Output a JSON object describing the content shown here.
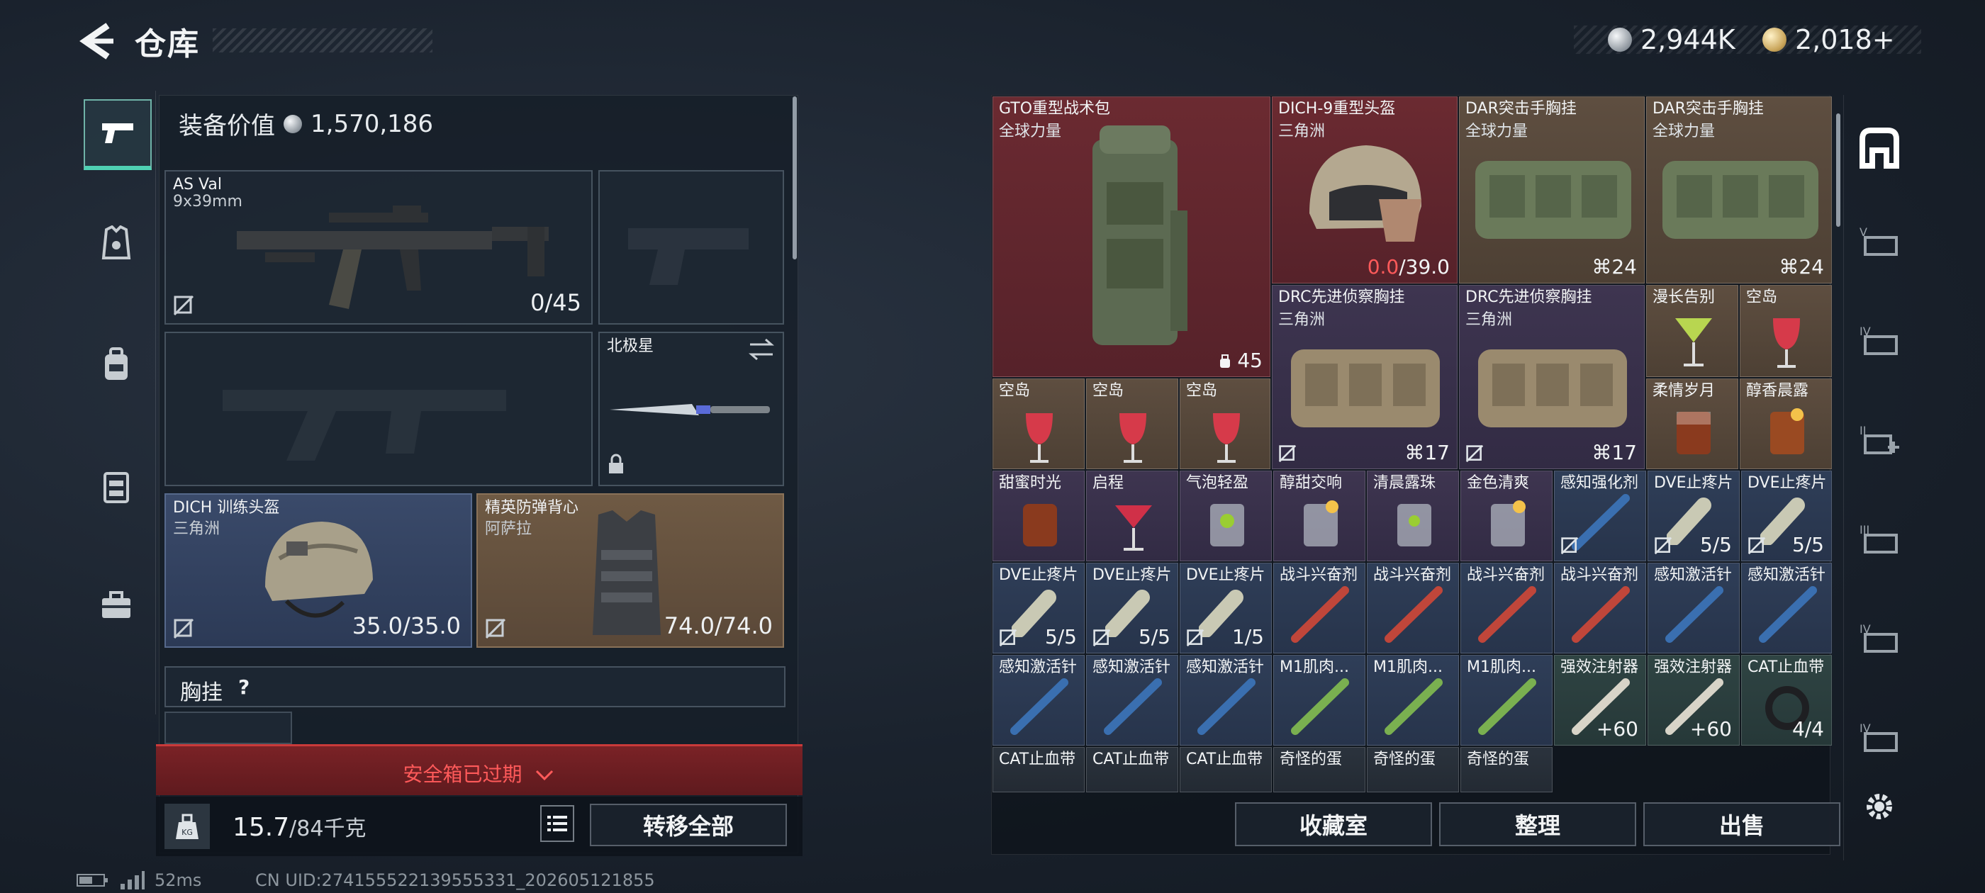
{
  "header": {
    "title": "仓库",
    "currency_silver": "2,944K",
    "currency_gold": "2,018+"
  },
  "equipment": {
    "value_label": "装备价值",
    "value": "1,570,186",
    "weapon1": {
      "name": "AS Val",
      "caliber": "9x39mm",
      "ammo": "0/45"
    },
    "melee": {
      "name": "北极星"
    },
    "helmet": {
      "name": "DICH 训练头盔",
      "sub": "三角洲",
      "durability": "35.0/35.0"
    },
    "armor": {
      "name": "精英防弹背心",
      "sub": "阿萨拉",
      "durability": "74.0/74.0"
    },
    "chest_label": "胸挂",
    "chest_help": "?",
    "expired": "安全箱已过期",
    "weight": "15.7",
    "weight_max": "/84千克",
    "transfer_all": "转移全部"
  },
  "inventory": {
    "items": [
      {
        "name": "GTO重型战术包",
        "sub": "全球力量",
        "qty": "45"
      },
      {
        "name": "DICH-9重型头盔",
        "sub": "三角洲",
        "dur_low": "0.0",
        "dur_max": "/39.0"
      },
      {
        "name": "DAR突击手胸挂",
        "sub": "全球力量",
        "qty": "24"
      },
      {
        "name": "DAR突击手胸挂",
        "sub": "全球力量",
        "qty": "24"
      },
      {
        "name": "DRC先进侦察胸挂",
        "sub": "三角洲",
        "qty": "17"
      },
      {
        "name": "DRC先进侦察胸挂",
        "sub": "三角洲",
        "qty": "17"
      },
      {
        "name": "漫长告别"
      },
      {
        "name": "空岛"
      },
      {
        "name": "柔情岁月"
      },
      {
        "name": "醇香晨露"
      },
      {
        "name": "空岛"
      },
      {
        "name": "空岛"
      },
      {
        "name": "空岛"
      },
      {
        "name": "甜蜜时光"
      },
      {
        "name": "启程"
      },
      {
        "name": "气泡轻盈"
      },
      {
        "name": "醇甜交响"
      },
      {
        "name": "清晨露珠"
      },
      {
        "name": "金色清爽"
      },
      {
        "name": "感知强化剂"
      },
      {
        "name": "DVE止疼片",
        "qty": "5/5"
      },
      {
        "name": "DVE止疼片",
        "qty": "5/5"
      },
      {
        "name": "DVE止疼片",
        "qty": "5/5"
      },
      {
        "name": "DVE止疼片",
        "qty": "5/5"
      },
      {
        "name": "DVE止疼片",
        "qty": "1/5"
      },
      {
        "name": "战斗兴奋剂"
      },
      {
        "name": "战斗兴奋剂"
      },
      {
        "name": "战斗兴奋剂"
      },
      {
        "name": "战斗兴奋剂"
      },
      {
        "name": "感知激活针"
      },
      {
        "name": "感知激活针"
      },
      {
        "name": "感知激活针"
      },
      {
        "name": "感知激活针"
      },
      {
        "name": "感知激活针"
      },
      {
        "name": "M1肌肉..."
      },
      {
        "name": "M1肌肉..."
      },
      {
        "name": "M1肌肉..."
      },
      {
        "name": "强效注射器",
        "qty": "+60"
      },
      {
        "name": "强效注射器",
        "qty": "+60"
      },
      {
        "name": "CAT止血带",
        "qty": "4/4"
      },
      {
        "name": "CAT止血带"
      },
      {
        "name": "CAT止血带"
      },
      {
        "name": "CAT止血带"
      },
      {
        "name": "奇怪的蛋"
      },
      {
        "name": "奇怪的蛋"
      },
      {
        "name": "奇怪的蛋"
      }
    ]
  },
  "actions": {
    "collection": "收藏室",
    "sort": "整理",
    "sell": "出售"
  },
  "status": {
    "ping": "52ms",
    "uid": "CN UID:274155522139555331_202605121855"
  }
}
